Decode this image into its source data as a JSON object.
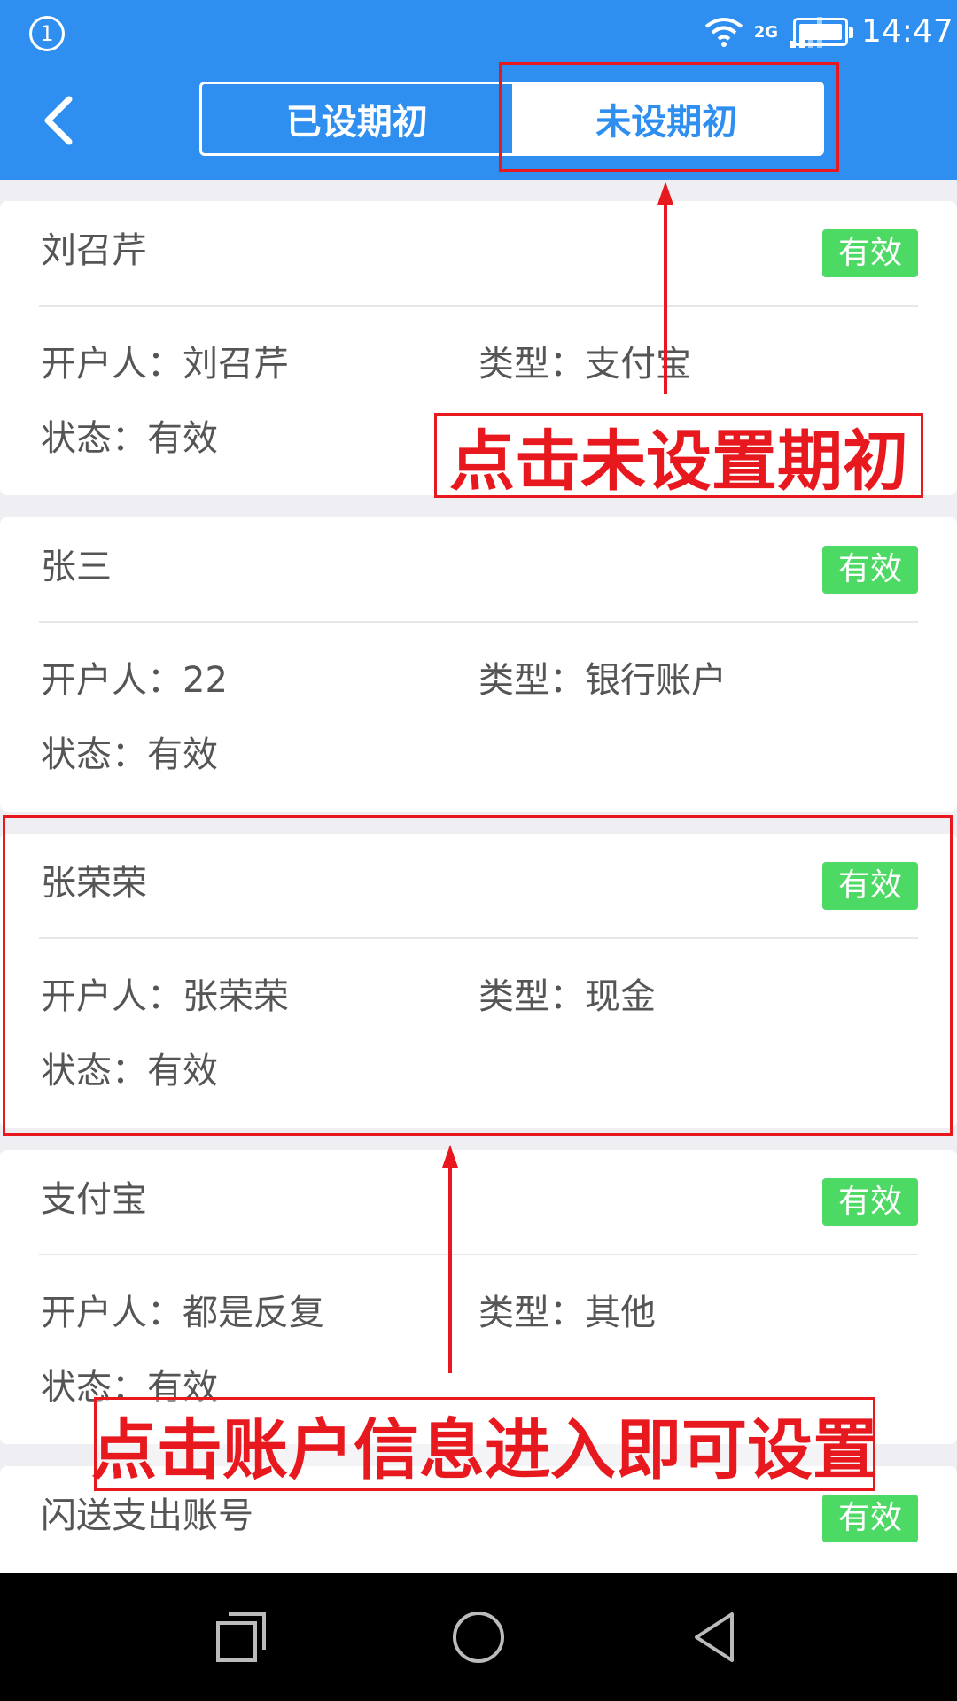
{
  "status_bar": {
    "notification_count": "1",
    "network_label": "2G",
    "time": "14:47"
  },
  "header": {
    "tabs": [
      {
        "label": "已设期初",
        "active": false
      },
      {
        "label": "未设期初",
        "active": true
      }
    ]
  },
  "accounts": [
    {
      "name": "刘召芹",
      "badge": "有效",
      "owner": "开户人：刘召芹",
      "type": "类型：支付宝",
      "status": "状态：有效"
    },
    {
      "name": "张三",
      "badge": "有效",
      "owner": "开户人：22",
      "type": "类型：银行账户",
      "status": "状态：有效"
    },
    {
      "name": "张荣荣",
      "badge": "有效",
      "owner": "开户人：张荣荣",
      "type": "类型：现金",
      "status": "状态：有效"
    },
    {
      "name": "支付宝",
      "badge": "有效",
      "owner": "开户人：都是反复",
      "type": "类型：其他",
      "status": "状态：有效"
    },
    {
      "name": "闪送支出账号",
      "badge": "有效"
    }
  ],
  "annotations": {
    "tab_hint": "点击未设置期初",
    "account_hint": "点击账户信息进入即可设置"
  },
  "colors": {
    "header_blue": "#2e8ff0",
    "badge_green": "#4cd964",
    "annotation_red": "#e8191e"
  },
  "icons": [
    "back-icon",
    "wifi-icon",
    "signal-icon",
    "battery-icon",
    "recent-apps-icon",
    "home-icon",
    "back-nav-icon"
  ]
}
